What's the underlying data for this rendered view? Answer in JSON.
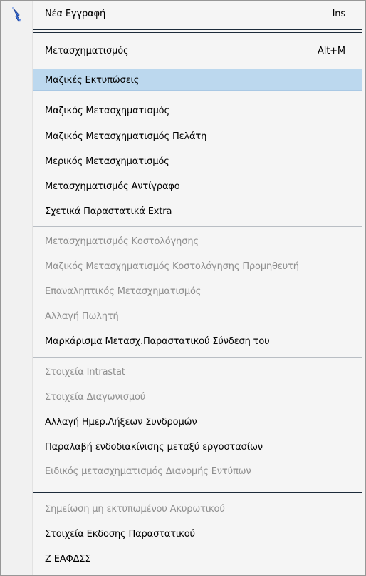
{
  "menu": {
    "icon": "wand-pointer-icon",
    "items": [
      {
        "label": "Νέα Εγγραφή",
        "shortcut": "Ins",
        "enabled": true
      },
      {
        "label": "Μετασχηματισμός",
        "shortcut": "Alt+M",
        "enabled": true
      },
      {
        "label": "Μαζικές Εκτυπώσεις",
        "enabled": true,
        "highlighted": true
      },
      {
        "label": "Μαζικός Μετασχηματισμός",
        "enabled": true
      },
      {
        "label": "Μαζικός Μετασχηματισμός Πελάτη",
        "enabled": true
      },
      {
        "label": "Μερικός Μετασχηματισμός",
        "enabled": true
      },
      {
        "label": "Μετασχηματισμός Αντίγραφο",
        "enabled": true
      },
      {
        "label": "Σχετικά Παραστατικά Extra",
        "enabled": true
      },
      {
        "label": "Μετασχηματισμός Κοστολόγησης",
        "enabled": false
      },
      {
        "label": "Μαζικός Μετασχηματισμός Κοστολόγησης Προμηθευτή",
        "enabled": false
      },
      {
        "label": "Επαναληπτικός Μετασχηματισμός",
        "enabled": false
      },
      {
        "label": "Αλλαγή Πωλητή",
        "enabled": false
      },
      {
        "label": "Μαρκάρισμα Μετασχ.Παραστατικού  Σύνδεση του",
        "enabled": true
      },
      {
        "label": "Στοιχεία Intrastat",
        "enabled": false
      },
      {
        "label": "Στοιχεία Διαγωνισμού",
        "enabled": false
      },
      {
        "label": "Αλλαγή Ημερ.Λήξεων Συνδρομών",
        "enabled": true
      },
      {
        "label": "Παραλαβή ενδοδιακίνισης μεταξύ εργοστασίων",
        "enabled": true
      },
      {
        "label": "Ειδικός μετασχηματισμός Διανομής Εντύπων",
        "enabled": false
      },
      {
        "label": "Σημείωση μη εκτυπωμένου Ακυρωτικού",
        "enabled": false
      },
      {
        "label": "Στοιχεία Εκδοσης Παραστατικού",
        "enabled": true
      },
      {
        "label": "Ζ ΕΑΦΔΣΣ",
        "enabled": true
      }
    ],
    "colors": {
      "highlight": "#bcd8ee",
      "disabled_text": "#8e8e8e",
      "separator_dark": "#1c2b3a",
      "separator_light": "#b9bec4"
    }
  }
}
